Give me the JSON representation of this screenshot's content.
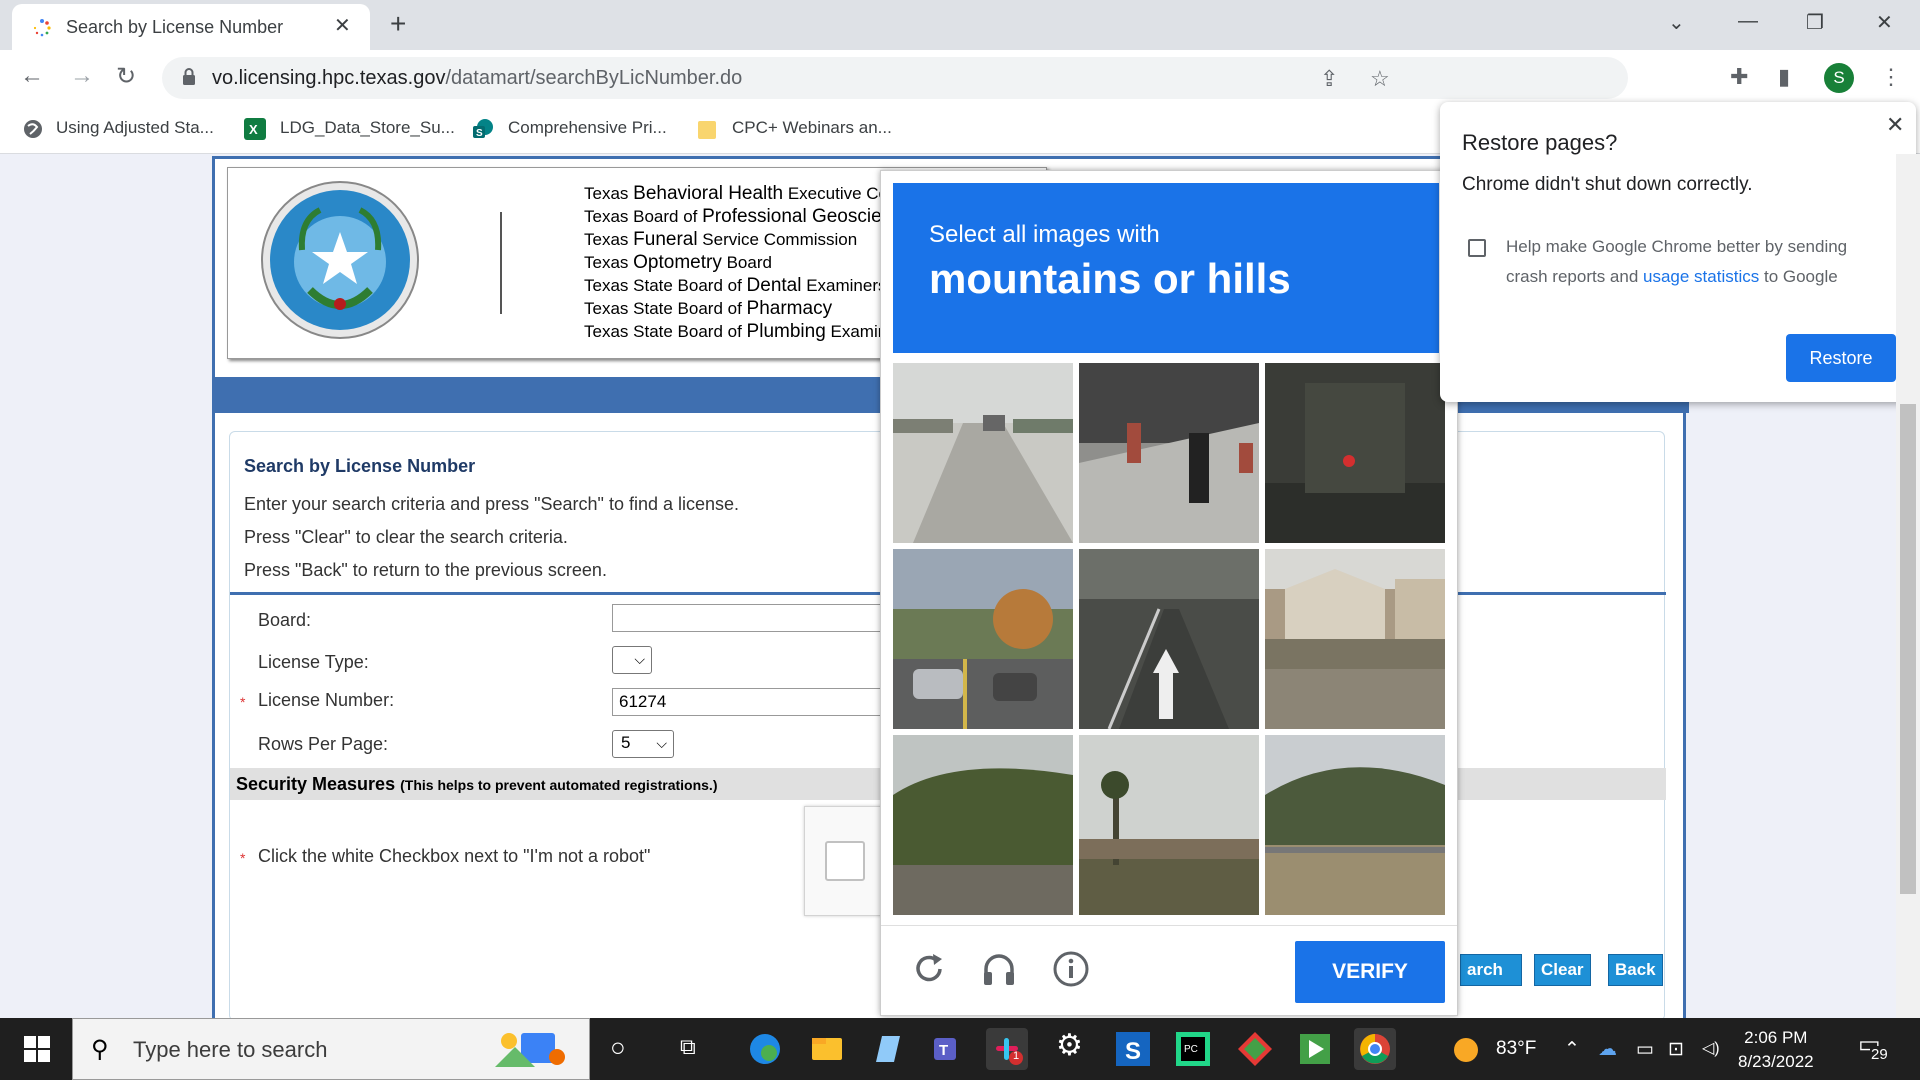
{
  "browser": {
    "tab_title": "Search by License Number",
    "url_host": "vo.licensing.hpc.texas.gov",
    "url_path": "/datamart/searchByLicNumber.do",
    "profile_initial": "S",
    "bookmarks": [
      {
        "label": "Using Adjusted Sta...",
        "icon": "globe-icon"
      },
      {
        "label": "LDG_Data_Store_Su...",
        "icon": "excel-icon"
      },
      {
        "label": "Comprehensive Pri...",
        "icon": "sharepoint-icon"
      },
      {
        "label": "CPC+ Webinars an...",
        "icon": "folder-icon"
      }
    ]
  },
  "header": {
    "agencies": [
      {
        "pre": "Texas ",
        "strong": "Behavioral Health",
        "post": " Executive Council"
      },
      {
        "pre": "Texas Board of ",
        "strong": "Professional Geoscientists",
        "post": ""
      },
      {
        "pre": "Texas ",
        "strong": "Funeral",
        "post": " Service Commission"
      },
      {
        "pre": "Texas ",
        "strong": "Optometry",
        "post": " Board"
      },
      {
        "pre": "Texas State Board of ",
        "strong": "Dental",
        "post": " Examiners"
      },
      {
        "pre": "Texas State Board of ",
        "strong": "Pharmacy",
        "post": ""
      },
      {
        "pre": "Texas State Board of ",
        "strong": "Plumbing",
        "post": " Examiners"
      }
    ]
  },
  "form": {
    "title": "Search by License Number",
    "desc1": "Enter your search criteria and press \"Search\" to find a license.",
    "desc2": "Press \"Clear\" to clear the search criteria.",
    "desc3": "Press \"Back\" to return to the previous screen.",
    "board_label": "Board:",
    "board_value": "",
    "license_type_label": "License Type:",
    "license_type_value": "",
    "license_number_label": "License Number:",
    "license_number_value": "61274",
    "rows_label": "Rows Per Page:",
    "rows_value": "5",
    "security_title": "Security Measures",
    "security_sub": "(This helps to prevent automated registrations.)",
    "robot_instruction": "Click the white Checkbox next to \"I'm not a robot\"",
    "search_btn": "arch",
    "clear_btn": "Clear",
    "back_btn": "Back"
  },
  "captcha": {
    "line1": "Select all images with",
    "line2": "mountains or hills",
    "verify": "VERIFY",
    "tiles": [
      {
        "desc": "road-scene"
      },
      {
        "desc": "sidewalk"
      },
      {
        "desc": "traffic-light"
      },
      {
        "desc": "cars-road"
      },
      {
        "desc": "lane-arrow"
      },
      {
        "desc": "houses"
      },
      {
        "desc": "hillside"
      },
      {
        "desc": "palm-tree"
      },
      {
        "desc": "hill-fence"
      }
    ]
  },
  "restore": {
    "title": "Restore pages?",
    "message": "Chrome didn't shut down correctly.",
    "option_pre": "Help make Google Chrome better by sending crash reports and ",
    "option_link": "usage statistics",
    "option_post": " to Google",
    "button": "Restore"
  },
  "taskbar": {
    "search_placeholder": "Type here to search",
    "temperature": "83°F",
    "time": "2:06 PM",
    "date": "8/23/2022",
    "notifications": "29",
    "slack_badge": "1"
  },
  "colors": {
    "accent": "#1a73e8",
    "state_blue": "#3f6fb0",
    "button_blue": "#1e90d6"
  }
}
